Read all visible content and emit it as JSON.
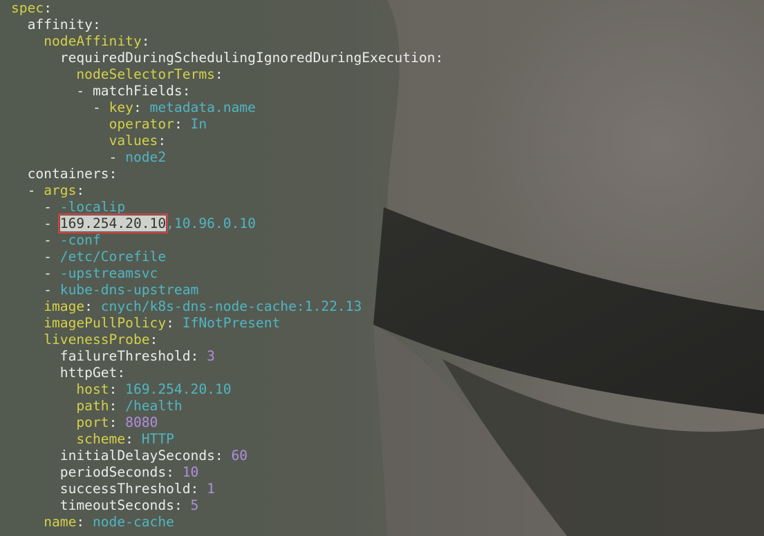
{
  "editor": {
    "lines": [
      {
        "indent": "",
        "key": "spec",
        "key_color": "yellow",
        "sep": ":",
        "value": "",
        "value_type": ""
      },
      {
        "indent": "  ",
        "key": "affinity",
        "key_color": "white",
        "sep": ":",
        "value": "",
        "value_type": ""
      },
      {
        "indent": "    ",
        "key": "nodeAffinity",
        "key_color": "yellow",
        "sep": ":",
        "value": "",
        "value_type": ""
      },
      {
        "indent": "      ",
        "key": "requiredDuringSchedulingIgnoredDuringExecution",
        "key_color": "white",
        "sep": ":",
        "value": "",
        "value_type": ""
      },
      {
        "indent": "        ",
        "key": "nodeSelectorTerms",
        "key_color": "yellow",
        "sep": ":",
        "value": "",
        "value_type": ""
      },
      {
        "indent": "        - ",
        "key": "matchFields",
        "key_color": "white",
        "sep": ":",
        "value": "",
        "value_type": ""
      },
      {
        "indent": "          - ",
        "key": "key",
        "key_color": "yellow",
        "sep": ": ",
        "value": "metadata.name",
        "value_type": "string"
      },
      {
        "indent": "            ",
        "key": "operator",
        "key_color": "yellow",
        "sep": ": ",
        "value": "In",
        "value_type": "string"
      },
      {
        "indent": "            ",
        "key": "values",
        "key_color": "yellow",
        "sep": ":",
        "value": "",
        "value_type": ""
      },
      {
        "indent": "            - ",
        "key": "",
        "key_color": "",
        "sep": "",
        "value": "node2",
        "value_type": "string"
      },
      {
        "indent": "  ",
        "key": "containers",
        "key_color": "white",
        "sep": ":",
        "value": "",
        "value_type": ""
      },
      {
        "indent": "  - ",
        "key": "args",
        "key_color": "yellow",
        "sep": ":",
        "value": "",
        "value_type": ""
      },
      {
        "indent": "    - ",
        "key": "",
        "key_color": "",
        "sep": "",
        "value": "-localip",
        "value_type": "string"
      },
      {
        "indent": "    - ",
        "key": "",
        "key_color": "",
        "sep": "",
        "value": "",
        "value_type": "",
        "highlight": "169.254.20.10",
        "rest": ",10.96.0.10"
      },
      {
        "indent": "    - ",
        "key": "",
        "key_color": "",
        "sep": "",
        "value": "-conf",
        "value_type": "string"
      },
      {
        "indent": "    - ",
        "key": "",
        "key_color": "",
        "sep": "",
        "value": "/etc/Corefile",
        "value_type": "string"
      },
      {
        "indent": "    - ",
        "key": "",
        "key_color": "",
        "sep": "",
        "value": "-upstreamsvc",
        "value_type": "string"
      },
      {
        "indent": "    - ",
        "key": "",
        "key_color": "",
        "sep": "",
        "value": "kube-dns-upstream",
        "value_type": "string"
      },
      {
        "indent": "    ",
        "key": "image",
        "key_color": "yellow",
        "sep": ": ",
        "value": "cnych/k8s-dns-node-cache:1.22.13",
        "value_type": "string"
      },
      {
        "indent": "    ",
        "key": "imagePullPolicy",
        "key_color": "yellow",
        "sep": ": ",
        "value": "IfNotPresent",
        "value_type": "string"
      },
      {
        "indent": "    ",
        "key": "livenessProbe",
        "key_color": "yellow",
        "sep": ":",
        "value": "",
        "value_type": ""
      },
      {
        "indent": "      ",
        "key": "failureThreshold",
        "key_color": "white",
        "sep": ": ",
        "value": "3",
        "value_type": "number"
      },
      {
        "indent": "      ",
        "key": "httpGet",
        "key_color": "white",
        "sep": ":",
        "value": "",
        "value_type": ""
      },
      {
        "indent": "        ",
        "key": "host",
        "key_color": "yellow",
        "sep": ": ",
        "value": "169.254.20.10",
        "value_type": "string"
      },
      {
        "indent": "        ",
        "key": "path",
        "key_color": "yellow",
        "sep": ": ",
        "value": "/health",
        "value_type": "string"
      },
      {
        "indent": "        ",
        "key": "port",
        "key_color": "yellow",
        "sep": ": ",
        "value": "8080",
        "value_type": "number"
      },
      {
        "indent": "        ",
        "key": "scheme",
        "key_color": "yellow",
        "sep": ": ",
        "value": "HTTP",
        "value_type": "string"
      },
      {
        "indent": "      ",
        "key": "initialDelaySeconds",
        "key_color": "white",
        "sep": ": ",
        "value": "60",
        "value_type": "number"
      },
      {
        "indent": "      ",
        "key": "periodSeconds",
        "key_color": "white",
        "sep": ": ",
        "value": "10",
        "value_type": "number"
      },
      {
        "indent": "      ",
        "key": "successThreshold",
        "key_color": "white",
        "sep": ": ",
        "value": "1",
        "value_type": "number"
      },
      {
        "indent": "      ",
        "key": "timeoutSeconds",
        "key_color": "white",
        "sep": ": ",
        "value": "5",
        "value_type": "number"
      },
      {
        "indent": "    ",
        "key": "name",
        "key_color": "yellow",
        "sep": ": ",
        "value": "node-cache",
        "value_type": "string"
      }
    ]
  },
  "colors": {
    "key_yellow": "#d4d14a",
    "key_white": "#ececec",
    "string_cyan": "#4fb6c4",
    "number_purple": "#b08ee0",
    "highlight_box": "#d84040"
  }
}
